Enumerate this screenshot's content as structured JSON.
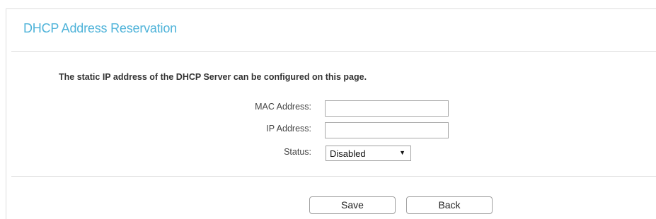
{
  "header": {
    "title": "DHCP Address Reservation"
  },
  "description": "The static IP address of the DHCP Server can be configured on this page.",
  "form": {
    "mac_label": "MAC Address:",
    "mac_value": "",
    "ip_label": "IP Address:",
    "ip_value": "",
    "status_label": "Status:",
    "status_selected": "Disabled"
  },
  "actions": {
    "save_label": "Save",
    "back_label": "Back"
  },
  "colors": {
    "title": "#4fb3d9",
    "rule": "#dcdcdc",
    "border": "#a9a9a9"
  },
  "icons": {
    "dropdown": "caret-down-icon"
  }
}
